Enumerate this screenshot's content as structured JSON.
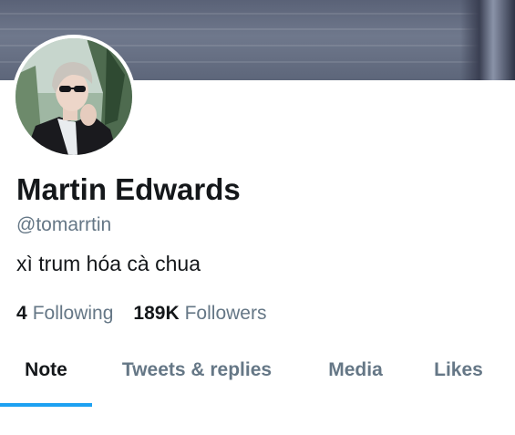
{
  "profile": {
    "name": "Martin Edwards",
    "handle": "@tomarrtin",
    "bio": "xì trum hóa cà chua",
    "avatar_icon": "profile-photo"
  },
  "stats": {
    "following_count": "4",
    "following_label": "Following",
    "followers_count": "189K",
    "followers_label": "Followers"
  },
  "tabs": [
    {
      "label": "Note",
      "active": true
    },
    {
      "label": "Tweets & replies",
      "active": false
    },
    {
      "label": "Media",
      "active": false
    },
    {
      "label": "Likes",
      "active": false
    }
  ],
  "colors": {
    "accent": "#1da1f2",
    "secondary_text": "#657786",
    "primary_text": "#14171a"
  }
}
